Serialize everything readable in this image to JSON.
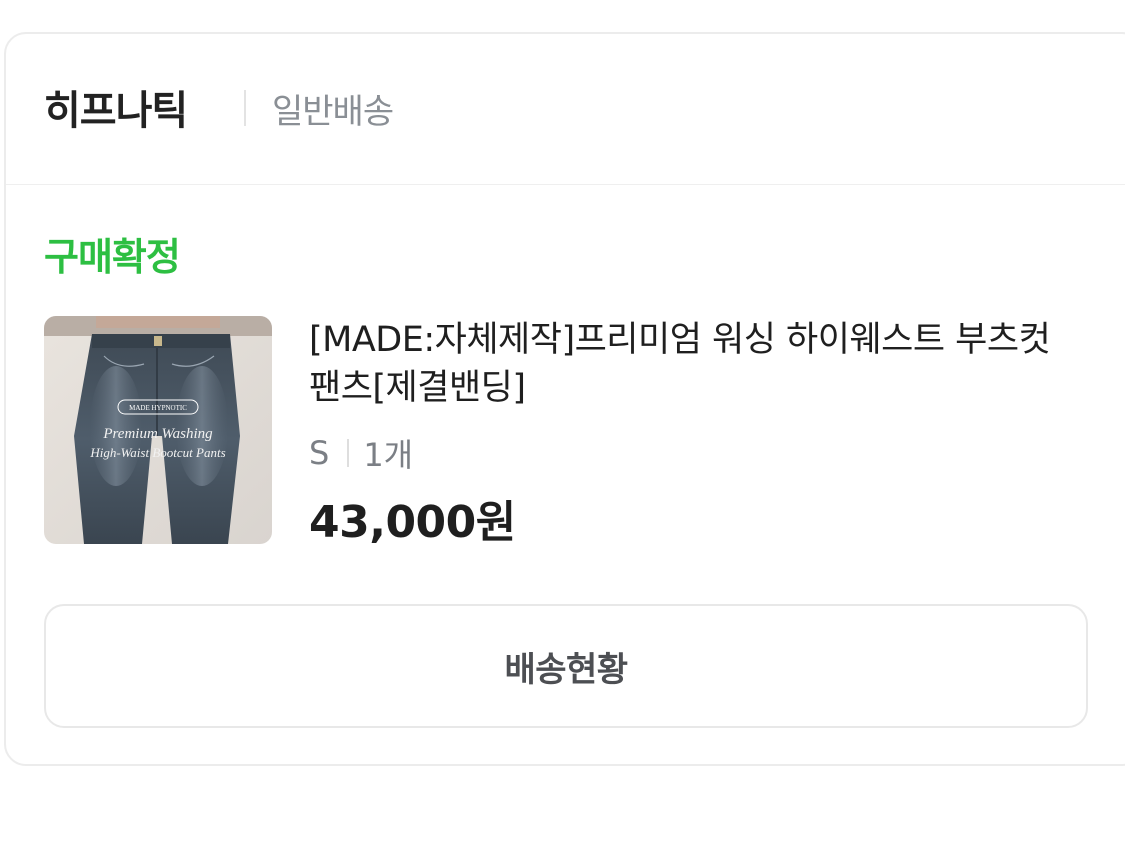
{
  "order": {
    "store_name": "히프나틱",
    "shipping_type": "일반배송",
    "status": "구매확정",
    "status_color": "#2dbf42",
    "item": {
      "title": "[MADE:자체제작]프리미엄 워싱 하이웨스트 부츠컷팬츠[제결밴딩]",
      "option": "S",
      "quantity": "1개",
      "price": "43,000원",
      "thumbnail": {
        "brand_badge": "MADE HYPNOTIC",
        "caption_line1": "Premium Washing",
        "caption_line2": "High-Waist Bootcut Pants"
      }
    },
    "track_button_label": "배송현황"
  }
}
